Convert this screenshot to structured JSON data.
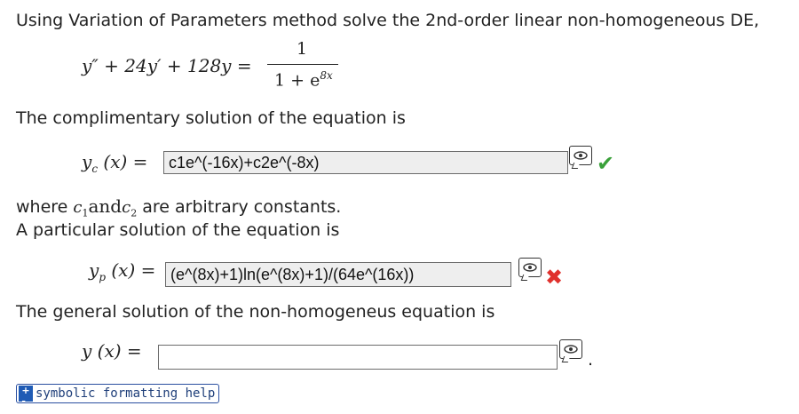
{
  "problem": {
    "intro": "Using Variation of Parameters method solve the 2nd-order linear non-homogeneous DE,",
    "equation_lhs": "y″ + 24y′ + 128y =",
    "equation_numerator": "1",
    "equation_denominator": "1 + e",
    "equation_denominator_exp": "8x"
  },
  "complementary": {
    "text": "The complimentary solution of the equation is",
    "lhs": "y",
    "lhs_sub": "c",
    "lhs_rest": "(x) =",
    "value": "c1e^(-16x)+c2e^(-8x)",
    "status": "correct"
  },
  "constants": {
    "where": "where",
    "c1": "c",
    "c1_sub": "1",
    "and": "and",
    "c2": "c",
    "c2_sub": "2",
    "rest": "are arbitrary constants."
  },
  "particular": {
    "text": "A particular solution of the equation is",
    "lhs": "y",
    "lhs_sub": "p",
    "lhs_rest": "(x) =",
    "value": "(e^(8x)+1)ln(e^(8x)+1)/(64e^(16x))",
    "status": "incorrect"
  },
  "general": {
    "text": "The general solution of the non-homogeneus equation is",
    "lhs": "y",
    "lhs_rest": "(x) =",
    "value": "",
    "period": "."
  },
  "icons": {
    "preview": "eye-preview-icon",
    "correct": "checkmark-icon",
    "incorrect": "x-mark-icon",
    "help": "plus-minus-help-icon"
  },
  "colors": {
    "correct": "#3aa13a",
    "incorrect": "#e0312d",
    "help_border": "#2a4fa0"
  },
  "help_button": {
    "label": "symbolic formatting help"
  }
}
